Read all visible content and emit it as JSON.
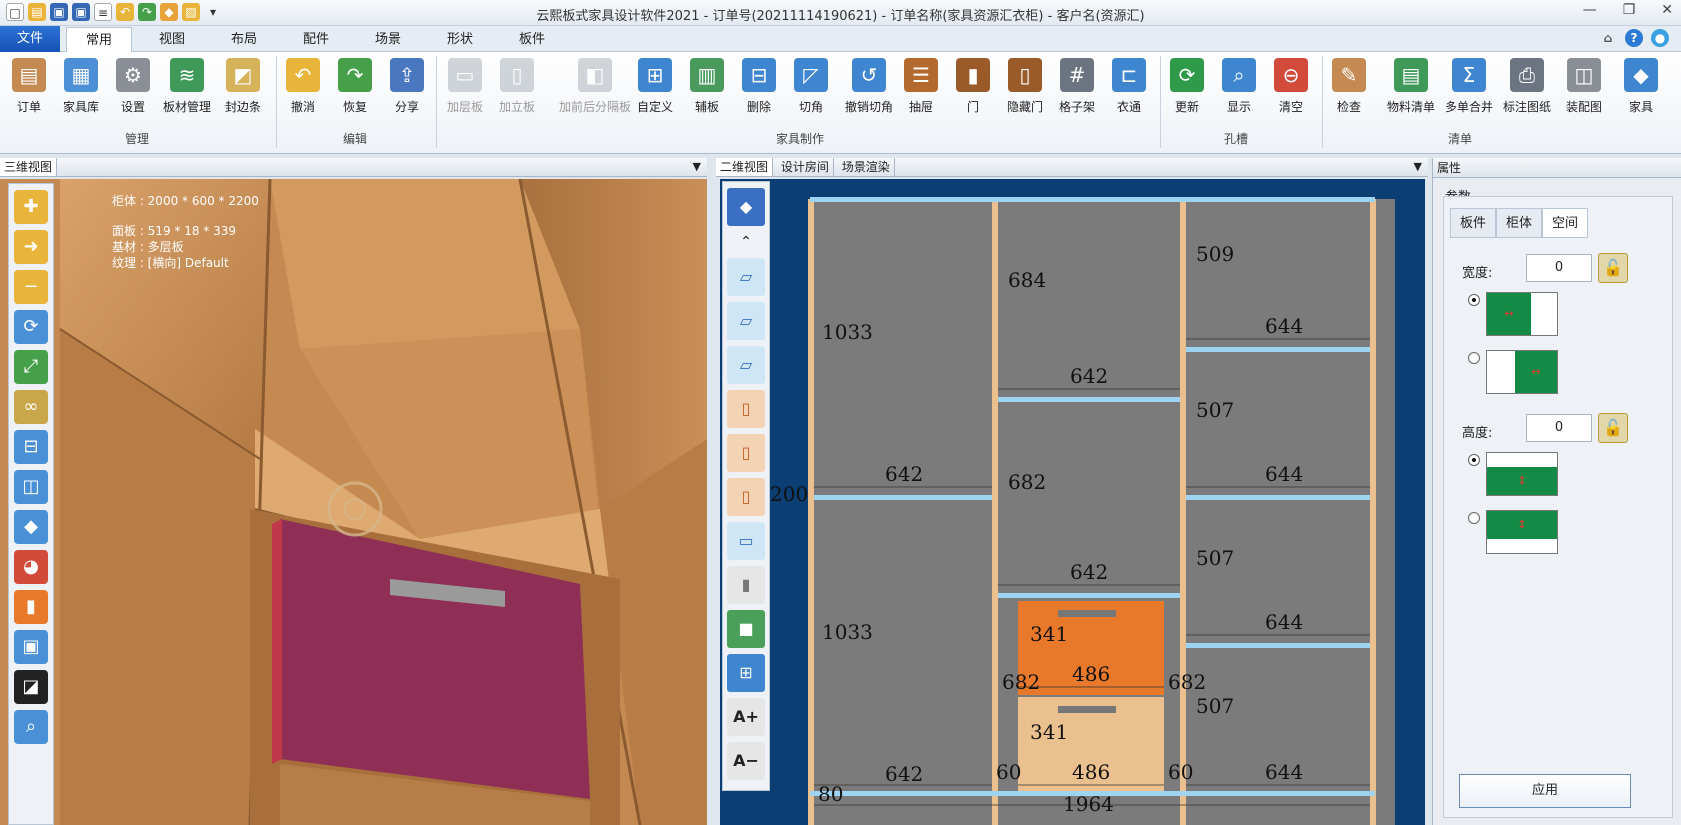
{
  "window": {
    "title": "云熙板式家具设计软件2021 - 订单号(20211114190621) - 订单名称(家具资源汇衣柜) - 客户名(资源汇)"
  },
  "tabs": [
    "文件",
    "常用",
    "视图",
    "布局",
    "配件",
    "场景",
    "形状",
    "板件"
  ],
  "ribbon": {
    "groups": [
      {
        "label": "管理",
        "buttons": [
          "订单",
          "家具库",
          "设置",
          "板材管理",
          "封边条"
        ]
      },
      {
        "label": "编辑",
        "buttons": [
          "撤消",
          "恢复",
          "分享"
        ]
      },
      {
        "label": "家具制作",
        "buttons": [
          "加层板",
          "加立板",
          "加前后分隔板",
          "自定义",
          "辅板",
          "删除",
          "切角",
          "撤销切角",
          "抽屉",
          "门",
          "隐藏门",
          "格子架",
          "衣通"
        ]
      },
      {
        "label": "孔槽",
        "buttons": [
          "更新",
          "显示",
          "清空"
        ]
      },
      {
        "label": "清单",
        "buttons": [
          "检查",
          "物料清单",
          "多单合并",
          "标注图纸",
          "装配图",
          "家具"
        ]
      }
    ],
    "disabled": [
      "加层板",
      "加立板",
      "加前后分隔板"
    ]
  },
  "panes": {
    "view3d_title": "三维视图",
    "view2d_tabs": [
      "二维视图",
      "设计房间",
      "场景渲染"
    ],
    "props_title": "属性"
  },
  "info": {
    "cabinet": "柜体 : 2000 * 600 * 2200",
    "panel": "面板 : 519 * 18 * 339",
    "material": "基材 : 多层板",
    "texture": "纹理 : [横向] Default"
  },
  "dims": {
    "top": [
      "684",
      "509"
    ],
    "col1": [
      "1033",
      "642",
      "1033",
      "642"
    ],
    "col2": [
      "642",
      "682",
      "642",
      "341",
      "486",
      "341",
      "486"
    ],
    "col3": [
      "644",
      "507",
      "644",
      "507",
      "644",
      "507",
      "644"
    ],
    "sides": [
      "200",
      "682",
      "682",
      "60",
      "60",
      "80"
    ],
    "total": "1964"
  },
  "props": {
    "section": "参数",
    "tabs": [
      "板件",
      "柜体",
      "空间"
    ],
    "width_label": "宽度:",
    "width_value": "0",
    "height_label": "高度:",
    "height_value": "0",
    "apply": "应用"
  },
  "colors": {
    "wood": "#c58a52",
    "drawer3d": "#8f2f55",
    "blueprint": "#0b3f73",
    "cell": "#7b7b7b",
    "drawer_orange": "#e8782a",
    "drawer_tan": "#e9c08e",
    "shelf": "#9fd3f2"
  }
}
